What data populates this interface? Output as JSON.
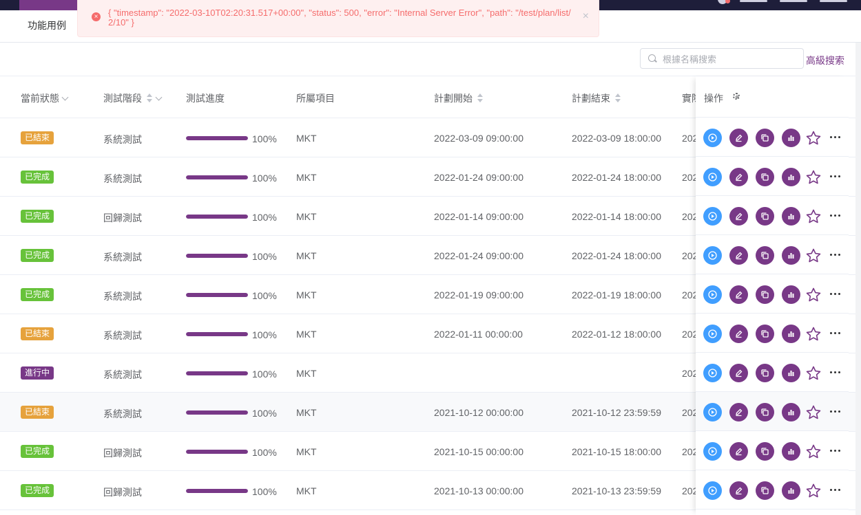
{
  "colors": {
    "primary": "#783887",
    "info": "#409eff",
    "success": "#67c23a",
    "warning": "#e6a23c",
    "danger": "#f56c6c",
    "topbar": "#1e1e3a"
  },
  "subnav": {
    "tab_label": "功能用例"
  },
  "alert": {
    "message": "{ \"timestamp\": \"2022-03-10T02:20:31.517+00:00\", \"status\": 500, \"error\": \"Internal Server Error\", \"path\": \"/test/plan/list/2/10\" }",
    "close": "×"
  },
  "toolbar": {
    "search_placeholder": "根據名稱搜索",
    "advanced_search": "高級搜索"
  },
  "columns": {
    "status": "當前狀態",
    "stage": "測試階段",
    "progress": "測試進度",
    "project": "所屬項目",
    "plan_start": "計劃開始",
    "plan_end": "計劃結束",
    "actual": "實際",
    "actions": "操作"
  },
  "rows": [
    {
      "status": "已結束",
      "status_color": "#e6a23c",
      "stage": "系統測試",
      "progress": 100,
      "progress_text": "100%",
      "project": "MKT",
      "plan_start": "2022-03-09 09:00:00",
      "plan_end": "2022-03-09 18:00:00",
      "actual": "202"
    },
    {
      "status": "已完成",
      "status_color": "#67c23a",
      "stage": "系統測試",
      "progress": 100,
      "progress_text": "100%",
      "project": "MKT",
      "plan_start": "2022-01-24 09:00:00",
      "plan_end": "2022-01-24 18:00:00",
      "actual": "202"
    },
    {
      "status": "已完成",
      "status_color": "#67c23a",
      "stage": "回歸測試",
      "progress": 100,
      "progress_text": "100%",
      "project": "MKT",
      "plan_start": "2022-01-14 09:00:00",
      "plan_end": "2022-01-14 18:00:00",
      "actual": "202"
    },
    {
      "status": "已完成",
      "status_color": "#67c23a",
      "stage": "系統測試",
      "progress": 100,
      "progress_text": "100%",
      "project": "MKT",
      "plan_start": "2022-01-24 09:00:00",
      "plan_end": "2022-01-24 18:00:00",
      "actual": "202"
    },
    {
      "status": "已完成",
      "status_color": "#67c23a",
      "stage": "系統測試",
      "progress": 100,
      "progress_text": "100%",
      "project": "MKT",
      "plan_start": "2022-01-19 09:00:00",
      "plan_end": "2022-01-19 18:00:00",
      "actual": "202"
    },
    {
      "status": "已結束",
      "status_color": "#e6a23c",
      "stage": "系統測試",
      "progress": 100,
      "progress_text": "100%",
      "project": "MKT",
      "plan_start": "2022-01-11 00:00:00",
      "plan_end": "2022-01-12 18:00:00",
      "actual": "202"
    },
    {
      "status": "進行中",
      "status_color": "#783887",
      "stage": "系統測試",
      "progress": 100,
      "progress_text": "100%",
      "project": "MKT",
      "plan_start": "",
      "plan_end": "",
      "actual": "202"
    },
    {
      "status": "已結束",
      "status_color": "#e6a23c",
      "stage": "系統測試",
      "progress": 100,
      "progress_text": "100%",
      "project": "MKT",
      "plan_start": "2021-10-12 00:00:00",
      "plan_end": "2021-10-12 23:59:59",
      "actual": "202",
      "hover": true
    },
    {
      "status": "已完成",
      "status_color": "#67c23a",
      "stage": "回歸測試",
      "progress": 100,
      "progress_text": "100%",
      "project": "MKT",
      "plan_start": "2021-10-15 00:00:00",
      "plan_end": "2021-10-15 18:00:00",
      "actual": "202"
    },
    {
      "status": "已完成",
      "status_color": "#67c23a",
      "stage": "回歸測試",
      "progress": 100,
      "progress_text": "100%",
      "project": "MKT",
      "plan_start": "2021-10-13 00:00:00",
      "plan_end": "2021-10-13 23:59:59",
      "actual": "202"
    }
  ],
  "icons": {
    "run": "play-circle-icon",
    "edit": "edit-icon",
    "copy": "copy-icon",
    "report": "bar-chart-icon",
    "favorite": "star-icon",
    "more": "more-icon",
    "settings": "gear-icon",
    "search": "search-icon",
    "notification": "bell-icon",
    "error": "error-circle-icon"
  }
}
